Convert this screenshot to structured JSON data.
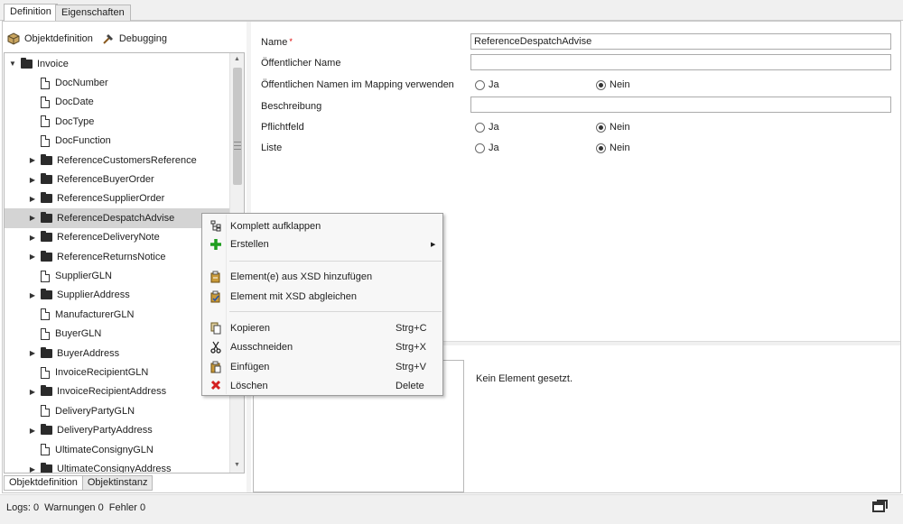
{
  "tabs": [
    {
      "label": "Definition",
      "active": true
    },
    {
      "label": "Eigenschaften",
      "active": false
    }
  ],
  "toolbar": {
    "objektdefinition_label": "Objektdefinition",
    "debugging_label": "Debugging"
  },
  "tree": {
    "items": [
      {
        "label": "Invoice",
        "type": "folder",
        "expanded": true,
        "level": 0
      },
      {
        "label": "DocNumber",
        "type": "doc",
        "level": 1
      },
      {
        "label": "DocDate",
        "type": "doc",
        "level": 1
      },
      {
        "label": "DocType",
        "type": "doc",
        "level": 1
      },
      {
        "label": "DocFunction",
        "type": "doc",
        "level": 1
      },
      {
        "label": "ReferenceCustomersReference",
        "type": "folder",
        "level": 1
      },
      {
        "label": "ReferenceBuyerOrder",
        "type": "folder",
        "level": 1
      },
      {
        "label": "ReferenceSupplierOrder",
        "type": "folder",
        "level": 1
      },
      {
        "label": "ReferenceDespatchAdvise",
        "type": "folder",
        "level": 1,
        "selected": true
      },
      {
        "label": "ReferenceDeliveryNote",
        "type": "folder",
        "level": 1
      },
      {
        "label": "ReferenceReturnsNotice",
        "type": "folder",
        "level": 1
      },
      {
        "label": "SupplierGLN",
        "type": "doc",
        "level": 1
      },
      {
        "label": "SupplierAddress",
        "type": "folder",
        "level": 1
      },
      {
        "label": "ManufacturerGLN",
        "type": "doc",
        "level": 1
      },
      {
        "label": "BuyerGLN",
        "type": "doc",
        "level": 1
      },
      {
        "label": "BuyerAddress",
        "type": "folder",
        "level": 1
      },
      {
        "label": "InvoiceRecipientGLN",
        "type": "doc",
        "level": 1
      },
      {
        "label": "InvoiceRecipientAddress",
        "type": "folder",
        "level": 1
      },
      {
        "label": "DeliveryPartyGLN",
        "type": "doc",
        "level": 1
      },
      {
        "label": "DeliveryPartyAddress",
        "type": "folder",
        "level": 1
      },
      {
        "label": "UltimateConsignyGLN",
        "type": "doc",
        "level": 1
      },
      {
        "label": "UltimateConsignyAddress",
        "type": "folder",
        "level": 1
      }
    ]
  },
  "bottom_tabs": [
    {
      "label": "Objektdefinition",
      "active": true
    },
    {
      "label": "Objektinstanz",
      "active": false
    }
  ],
  "properties": {
    "name_label": "Name",
    "name_required": "*",
    "name_value": "ReferenceDespatchAdvise",
    "public_name_label": "Öffentlicher Name",
    "public_name_value": "",
    "use_public_in_mapping_label": "Öffentlichen Namen im Mapping verwenden",
    "description_label": "Beschreibung",
    "description_value": "",
    "required_label": "Pflichtfeld",
    "list_label": "Liste",
    "yes_label": "Ja",
    "no_label": "Nein",
    "use_public_in_mapping_selected": "Nein",
    "required_selected": "Nein",
    "list_selected": "Nein"
  },
  "lower": {
    "empty_message": "Kein Element gesetzt."
  },
  "context_menu": {
    "items": [
      {
        "label": "Komplett aufklappen",
        "icon": "tree-expand-icon",
        "shortcut": ""
      },
      {
        "label": "Erstellen",
        "icon": "plus-icon",
        "shortcut": "",
        "submenu": true
      },
      {
        "label": "Element(e) aus XSD hinzufügen",
        "icon": "xsd-add-icon",
        "shortcut": ""
      },
      {
        "label": "Element mit XSD abgleichen",
        "icon": "xsd-sync-icon",
        "shortcut": ""
      },
      {
        "label": "Kopieren",
        "icon": "copy-icon",
        "shortcut": "Strg+C"
      },
      {
        "label": "Ausschneiden",
        "icon": "cut-icon",
        "shortcut": "Strg+X"
      },
      {
        "label": "Einfügen",
        "icon": "paste-icon",
        "shortcut": "Strg+V"
      },
      {
        "label": "Löschen",
        "icon": "delete-icon",
        "shortcut": "Delete"
      }
    ]
  },
  "status": {
    "logs": "Logs: 0",
    "warnings": "Warnungen 0",
    "errors": "Fehler 0"
  },
  "colors": {
    "add_green": "#1f9e1f",
    "delete_red": "#d42020",
    "required_red": "#dd0000",
    "selected_row": "#d4d4d4"
  }
}
